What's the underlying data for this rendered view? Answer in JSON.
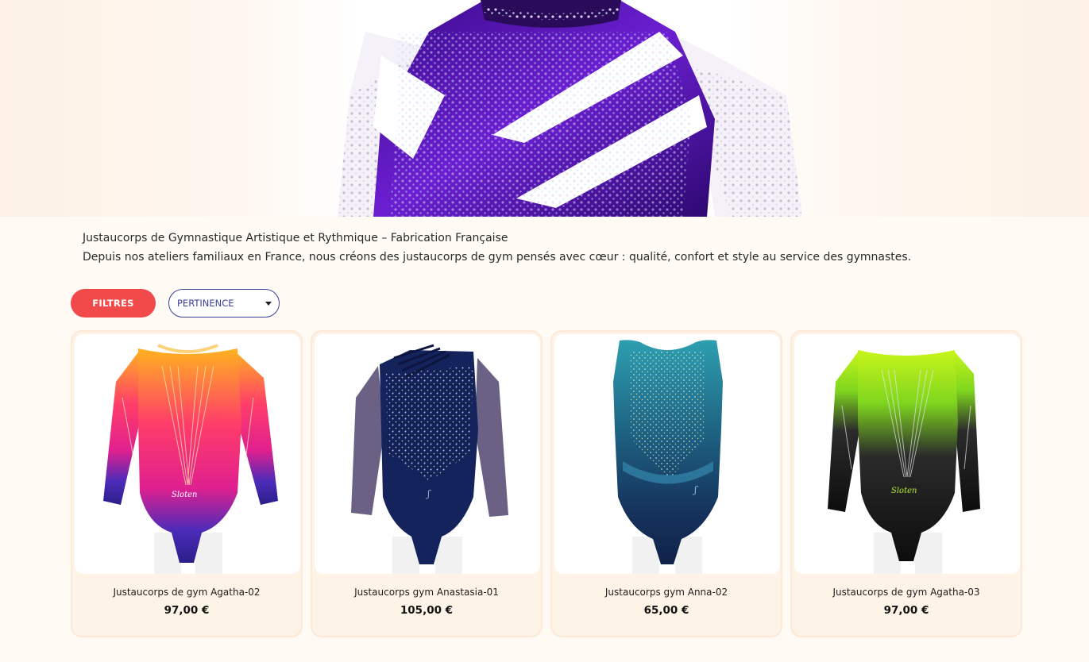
{
  "intro": {
    "line1": "Justaucorps de Gymnastique Artistique et Rythmique – Fabrication Française",
    "line2": "Depuis nos ateliers familiaux en France, nous créons des justaucorps de gym pensés avec cœur : qualité, confort et style au service des gymnastes."
  },
  "toolbar": {
    "filters_label": "FILTRES",
    "sort_value": "PERTINENCE"
  },
  "colors": {
    "accent": "#f2494b",
    "select_border": "#3b3f9a",
    "card_bg": "#fef3e7",
    "page_bg": "#fffaf4"
  },
  "products": [
    {
      "name": "Justaucorps de gym Agatha-02",
      "price": "97,00 €"
    },
    {
      "name": "Justaucorps gym Anastasia-01",
      "price": "105,00 €"
    },
    {
      "name": "Justaucorps gym Anna-02",
      "price": "65,00 €"
    },
    {
      "name": "Justaucorps de gym Agatha-03",
      "price": "97,00 €"
    }
  ]
}
